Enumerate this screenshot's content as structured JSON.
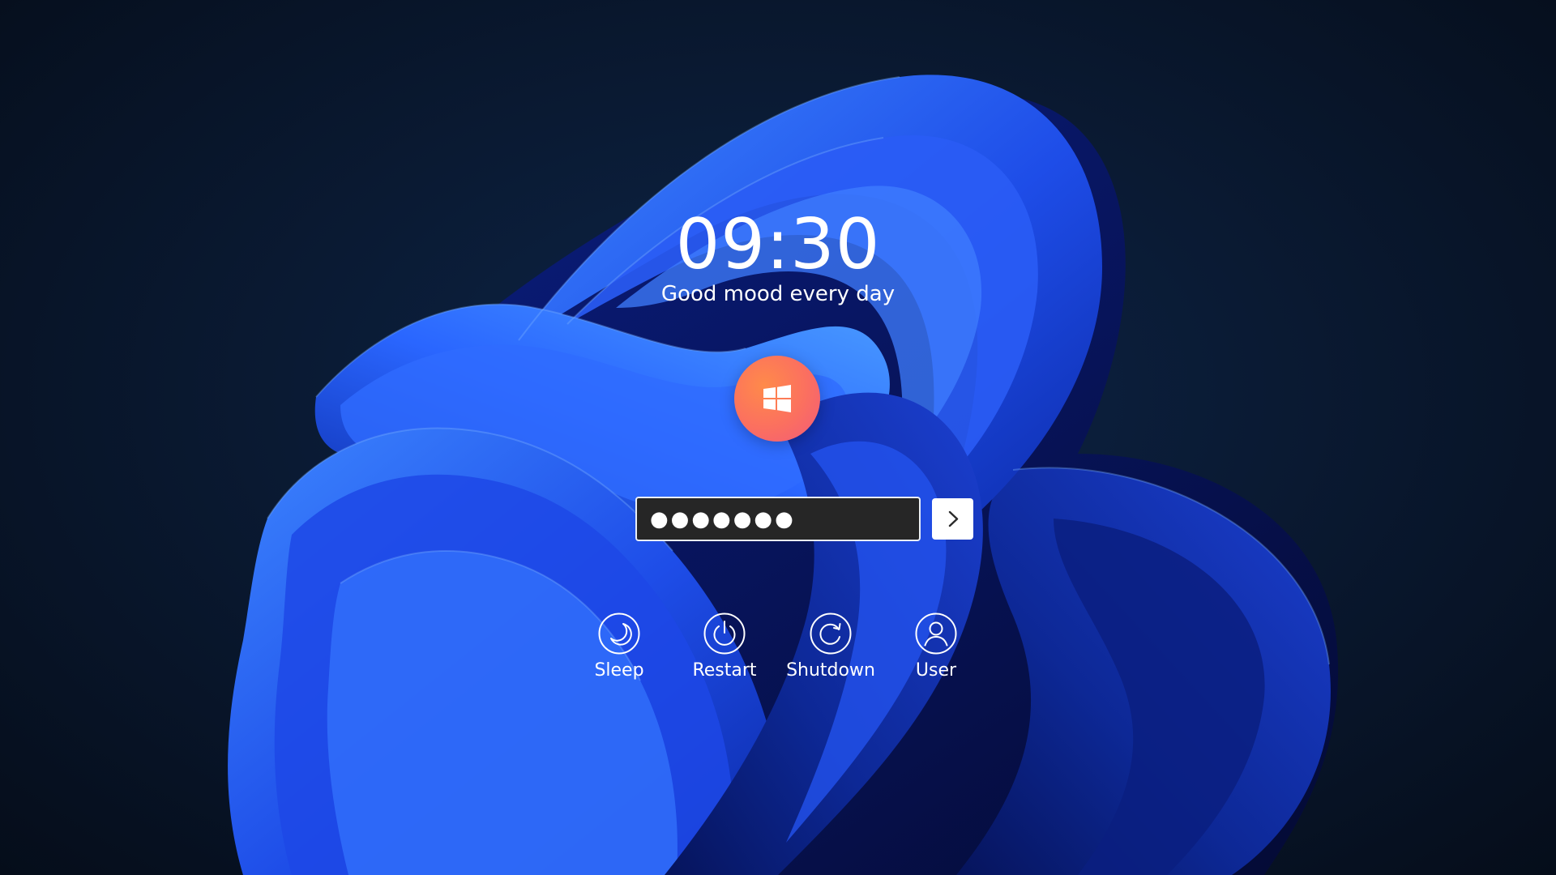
{
  "lock_screen": {
    "time": "09:30",
    "greeting": "Good mood every day",
    "avatar_icon": "windows-logo-icon",
    "password": {
      "masked_value": "●●●●●●●",
      "submit_icon": "chevron-right-icon"
    },
    "actions": [
      {
        "label": "Sleep",
        "icon": "moon-icon"
      },
      {
        "label": "Restart",
        "icon": "power-icon"
      },
      {
        "label": "Shutdown",
        "icon": "refresh-icon"
      },
      {
        "label": "User",
        "icon": "user-icon"
      }
    ]
  },
  "colors": {
    "background": "#07111f",
    "wallpaper_accent": "#1f4fff",
    "avatar_gradient_start": "#ff8a4a",
    "avatar_gradient_end": "#f15a7a",
    "password_field": "#262626",
    "text": "#ffffff"
  }
}
